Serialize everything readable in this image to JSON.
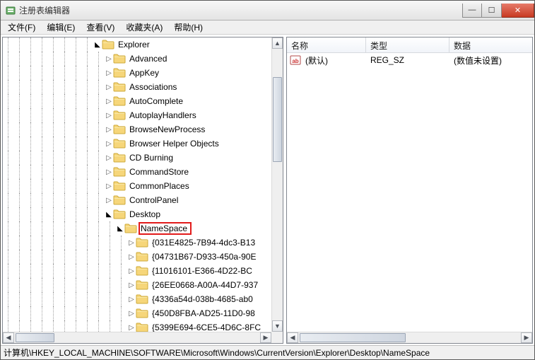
{
  "window": {
    "title": "注册表编辑器",
    "controls": {
      "min": "—",
      "max": "☐",
      "close": "✕"
    }
  },
  "menu": {
    "file": "文件(F)",
    "edit": "编辑(E)",
    "view": "查看(V)",
    "favorites": "收藏夹(A)",
    "help": "帮助(H)"
  },
  "tree": {
    "root": "Explorer",
    "selected": "NameSpace",
    "children": [
      "Advanced",
      "AppKey",
      "Associations",
      "AutoComplete",
      "AutoplayHandlers",
      "BrowseNewProcess",
      "Browser Helper Objects",
      "CD Burning",
      "CommandStore",
      "CommonPlaces",
      "ControlPanel"
    ],
    "desktop": "Desktop",
    "namespace": "NameSpace",
    "guids": [
      "{031E4825-7B94-4dc3-B13",
      "{04731B67-D933-450a-90E",
      "{11016101-E366-4D22-BC",
      "{26EE0668-A00A-44D7-937",
      "{4336a54d-038b-4685-ab0",
      "{450D8FBA-AD25-11D0-98",
      "{5399E694-6CE5-4D6C-8FC"
    ]
  },
  "list": {
    "headers": {
      "name": "名称",
      "type": "类型",
      "data": "数据"
    },
    "rows": [
      {
        "name": "(默认)",
        "type": "REG_SZ",
        "data": "(数值未设置)"
      }
    ]
  },
  "status": {
    "path": "计算机\\HKEY_LOCAL_MACHINE\\SOFTWARE\\Microsoft\\Windows\\CurrentVersion\\Explorer\\Desktop\\NameSpace"
  },
  "columns": {
    "name_w": 112,
    "type_w": 118,
    "data_w": 120
  }
}
